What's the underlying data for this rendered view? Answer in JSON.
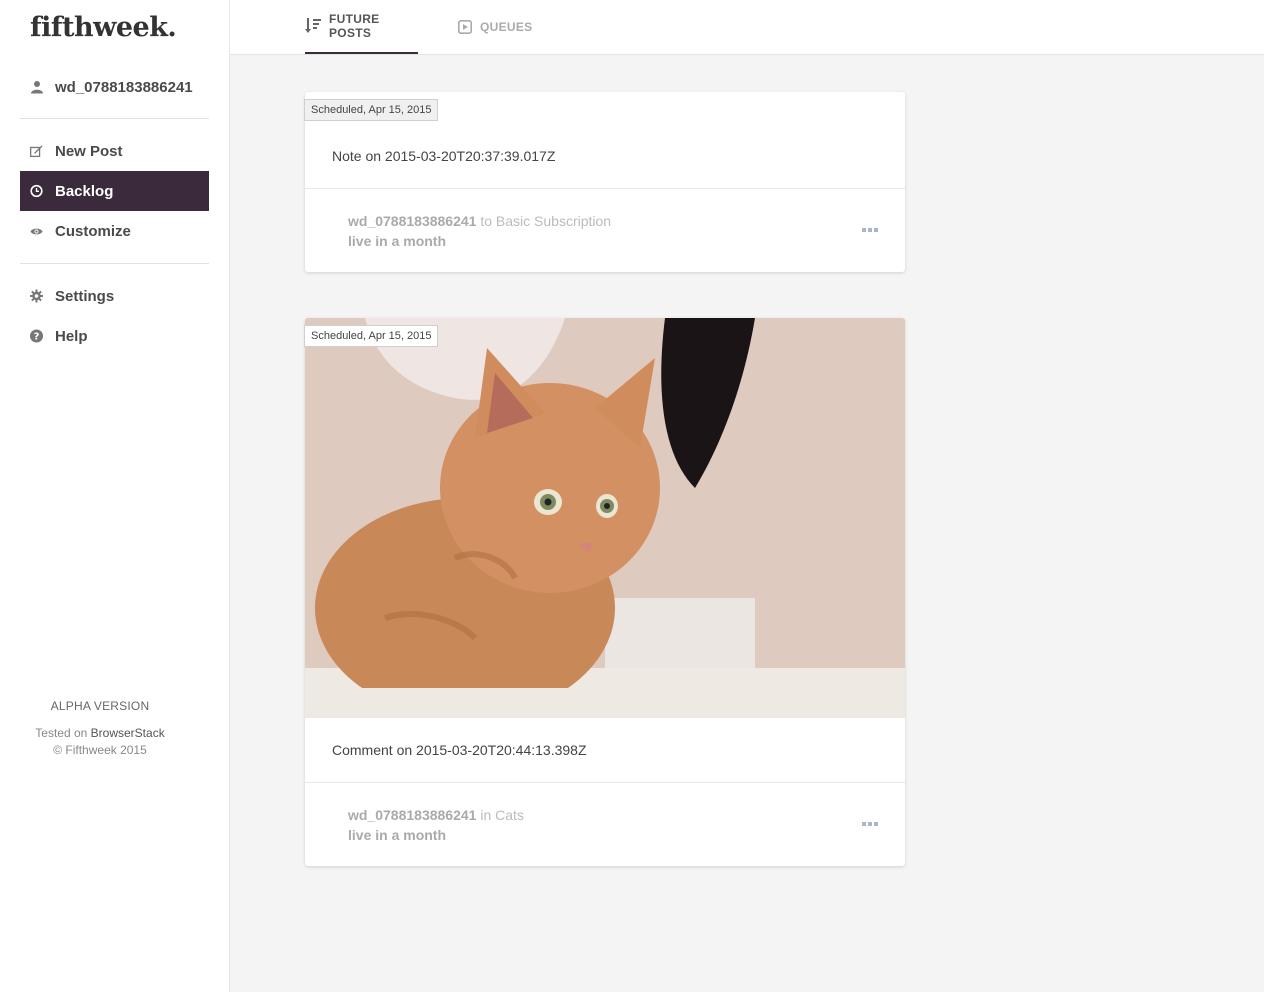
{
  "brand": {
    "logo": "fifthweek."
  },
  "sidebar": {
    "user": "wd_0788183886241",
    "items": [
      {
        "label": "New Post",
        "icon": "edit-icon"
      },
      {
        "label": "Backlog",
        "icon": "clock-icon",
        "active": true
      },
      {
        "label": "Customize",
        "icon": "eye-icon"
      },
      {
        "label": "Settings",
        "icon": "gear-icon"
      },
      {
        "label": "Help",
        "icon": "question-icon"
      }
    ],
    "footer": {
      "version": "ALPHA VERSION",
      "tested_prefix": "Tested on",
      "tested_link": "BrowserStack",
      "copyright": "© Fifthweek 2015"
    }
  },
  "tabs": [
    {
      "label": "FUTURE POSTS",
      "icon": "sort-icon",
      "active": true
    },
    {
      "label": "QUEUES",
      "icon": "play-square-icon",
      "active": false
    }
  ],
  "posts": [
    {
      "badge": "Scheduled, Apr 15, 2015",
      "title": "Note on 2015-03-20T20:37:39.017Z",
      "user": "wd_0788183886241",
      "connector": "to",
      "target": "Basic Subscription",
      "live": "live in a month"
    },
    {
      "badge": "Scheduled, Apr 15, 2015",
      "title": "Comment on 2015-03-20T20:44:13.398Z",
      "user": "wd_0788183886241",
      "connector": "in",
      "target": "Cats",
      "live": "live in a month",
      "image": "kitten-photo"
    }
  ]
}
